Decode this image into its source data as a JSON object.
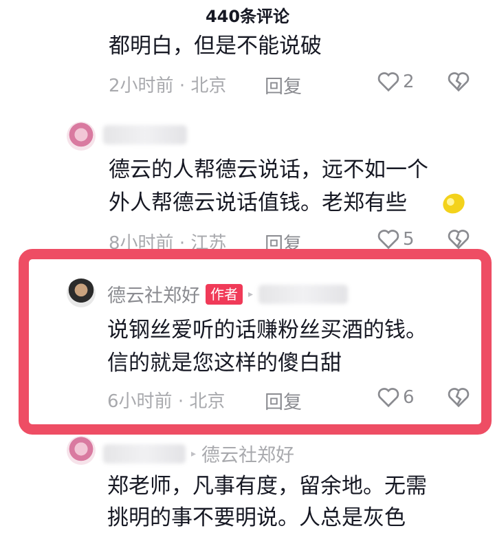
{
  "header": {
    "comment_count_title": "440条评论"
  },
  "comments": [
    {
      "text_lines": [
        "都明白，但是不能说破"
      ],
      "time": "2小时前",
      "location": "北京",
      "reply_label": "回复",
      "likes": "2"
    },
    {
      "text_lines": [
        "德云的人帮德云说话，远不如一个",
        "外人帮德云说话值钱。老郑有些"
      ],
      "emoji": "lemon",
      "time": "8小时前",
      "location": "江苏",
      "reply_label": "回复",
      "likes": "5"
    },
    {
      "username": "德云社郑好",
      "badge": "作者",
      "text_lines": [
        "说钢丝爱听的话赚粉丝买酒的钱。",
        "信的就是您这样的傻白甜"
      ],
      "time": "6小时前",
      "location": "北京",
      "reply_label": "回复",
      "likes": "6"
    },
    {
      "reply_to": "德云社郑好",
      "text_lines": [
        "郑老师，凡事有度，留余地。无需",
        "挑明的事不要明说。人总是灰色"
      ]
    }
  ],
  "meta_separator": "·",
  "colors": {
    "highlight_border": "#ee4d64",
    "author_badge": "#f03a58"
  },
  "icons": [
    "heart-outline-icon",
    "broken-heart-icon",
    "reply-arrow-icon",
    "lemon-emoji"
  ]
}
